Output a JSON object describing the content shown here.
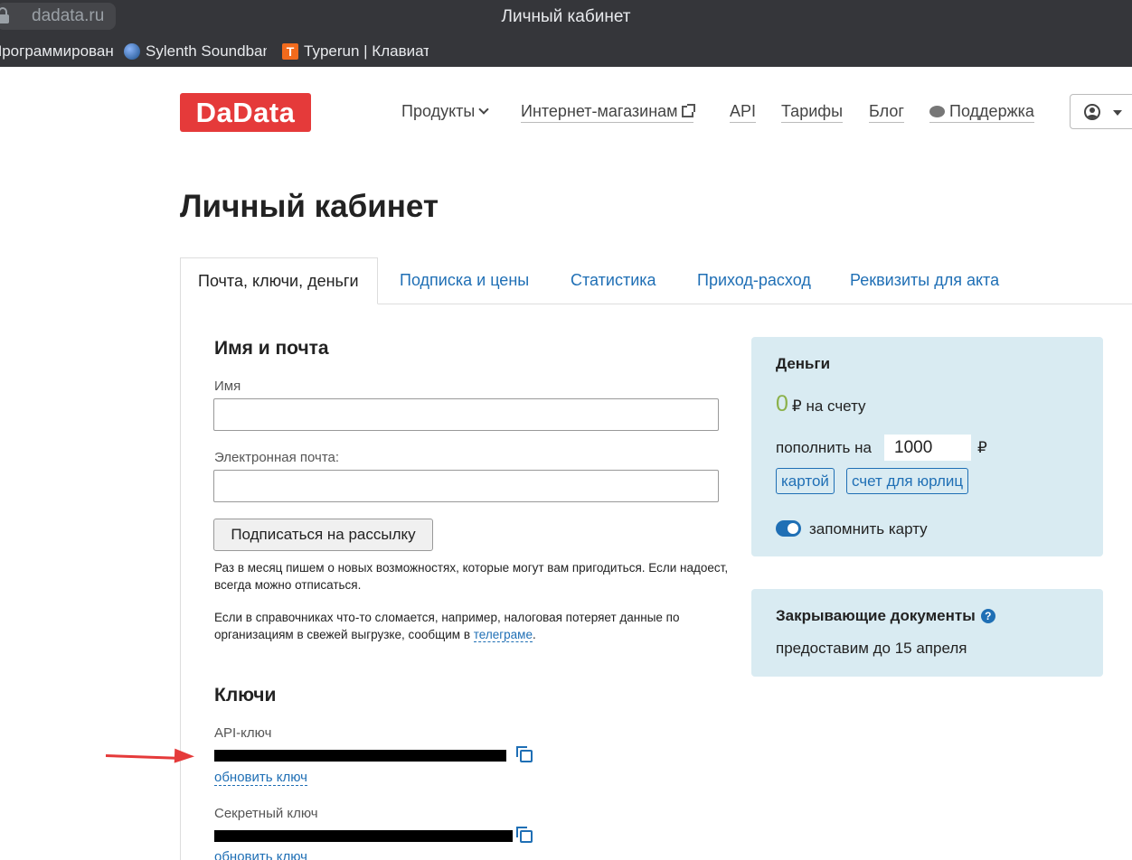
{
  "browser": {
    "url": "dadata.ru",
    "window_title": "Личный кабинет",
    "bookmarks": [
      {
        "label": "Программирован",
        "icon": "folder-icon"
      },
      {
        "label": "Sylenth Soundbanks",
        "icon": "globe-icon"
      },
      {
        "label": "Typerun | Клавиатурный",
        "icon": "typerun-icon"
      }
    ]
  },
  "header": {
    "logo": "DaData",
    "nav": {
      "products": "Продукты",
      "shops": "Интернет-магазинам",
      "api": "API",
      "tariffs": "Тарифы",
      "blog": "Блог",
      "support": "Поддержка"
    }
  },
  "page": {
    "title": "Личный кабинет",
    "tabs": [
      {
        "label": "Почта, ключи, деньги",
        "active": true
      },
      {
        "label": "Подписка и цены",
        "active": false
      },
      {
        "label": "Статистика",
        "active": false
      },
      {
        "label": "Приход-расход",
        "active": false
      },
      {
        "label": "Реквизиты для акта",
        "active": false
      }
    ]
  },
  "profile": {
    "heading": "Имя и почта",
    "name_label": "Имя",
    "name_value": "",
    "email_label": "Электронная почта:",
    "email_value": "",
    "subscribe_button": "Подписаться на рассылку",
    "note1": "Раз в месяц пишем о новых возможностях, которые могут вам пригодиться. Если надоест, всегда можно отписаться.",
    "note2_prefix": "Если в справочниках что-то сломается, например, налоговая потеряет данные по организациям в свежей выгрузке, сообщим в ",
    "note2_link": "телеграме",
    "note2_suffix": "."
  },
  "keys": {
    "heading": "Ключи",
    "api_label": "API-ключ",
    "secret_label": "Секретный ключ",
    "refresh_label": "обновить ключ"
  },
  "money": {
    "title": "Деньги",
    "balance": "0",
    "balance_suffix": "₽ на счету",
    "topup_label": "пополнить на",
    "topup_amount": "1000",
    "currency": "₽",
    "pay_card": "картой",
    "pay_invoice": "счет для юрлиц",
    "remember_card": "запомнить карту",
    "remember_card_on": true
  },
  "documents": {
    "title": "Закрывающие документы",
    "text": "предоставим до 15 апреля"
  },
  "colors": {
    "brand": "#e53a3a",
    "link": "#1f6fb5",
    "panel": "#d9ebf2",
    "balance": "#8bb14a"
  }
}
